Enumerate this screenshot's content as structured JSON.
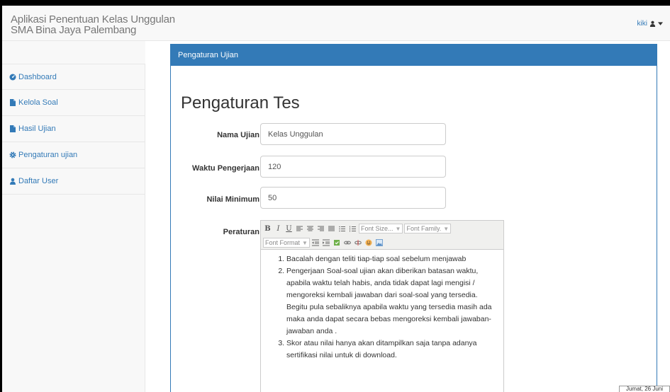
{
  "app": {
    "title_line1": "Aplikasi Penentuan Kelas Unggulan",
    "title_line2": "SMA Bina Jaya Palembang"
  },
  "user_menu": {
    "name": "kiki",
    "icon": "user-icon",
    "caret": "caret-down-icon"
  },
  "sidebar": {
    "items": [
      {
        "label": "Dashboard",
        "icon": "dashboard-icon"
      },
      {
        "label": "Kelola Soal",
        "icon": "file-icon"
      },
      {
        "label": "Hasil Ujian",
        "icon": "file-icon"
      },
      {
        "label": "Pengaturan ujian",
        "icon": "gear-icon"
      },
      {
        "label": "Daftar User",
        "icon": "user-icon"
      }
    ]
  },
  "panel": {
    "heading": "Pengaturan Ujian"
  },
  "page": {
    "title": "Pengaturan Tes"
  },
  "form": {
    "nama_ujian_label": "Nama Ujian",
    "nama_ujian_value": "Kelas Unggulan",
    "waktu_label": "Waktu Pengerjaan",
    "waktu_value": "120",
    "nilai_label": "Nilai Minimum",
    "nilai_value": "50",
    "peraturan_label": "Peraturan"
  },
  "editor": {
    "font_size_placeholder": "Font Size...",
    "font_family_placeholder": "Font Family.",
    "font_format_placeholder": "Font Format",
    "rules": [
      "Bacalah dengan teliti tiap-tiap soal sebelum menjawab",
      "Pengerjaan Soal-soal ujian akan diberikan batasan waktu, apabila waktu telah habis, anda tidak dapat lagi mengisi / mengoreksi kembali jawaban dari soal-soal yang tersedia. Begitu pula sebaliknya apabila waktu yang tersedia masih ada maka anda dapat secara bebas mengoreksi kembali jawaban-jawaban anda .",
      "Skor atau nilai hanya akan ditampilkan saja tanpa adanya sertifikasi nilai untuk di download."
    ]
  },
  "status": {
    "date": "Jumat, 26 Juni 2020"
  },
  "colors": {
    "primary": "#337ab7",
    "sidebar_bg": "#f8f8f8",
    "border": "#e7e7e7"
  }
}
